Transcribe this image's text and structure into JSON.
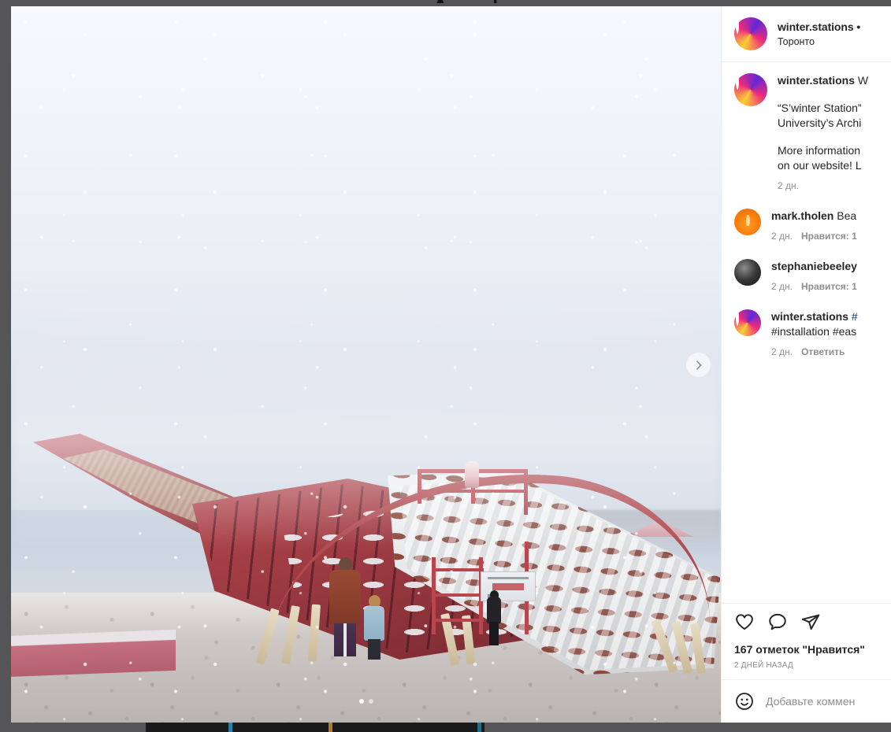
{
  "post": {
    "header": {
      "username": "winter.stations",
      "separator": "•",
      "location": "Торонто"
    },
    "caption": {
      "author": "winter.stations",
      "inline_text": "W",
      "paragraph_1_line_1": "“S’winter Station”",
      "paragraph_1_line_2": "University’s Archi",
      "paragraph_2_line_1": "More information",
      "paragraph_2_line_2": "on our website! L",
      "time": "2 дн."
    },
    "comments": [
      {
        "author": "mark.tholen",
        "text": "Bea",
        "time": "2 дн.",
        "likes": "Нравится: 1",
        "avatar": "flame-avatar"
      },
      {
        "author": "stephaniebeeley",
        "text": "",
        "time": "2 дн.",
        "likes": "Нравится: 1",
        "avatar": "dark-photo-avatar"
      },
      {
        "author": "winter.stations",
        "text": "#",
        "text_line_2": "#installation #eas",
        "time": "2 дн.",
        "reply": "Ответить",
        "avatar": "winter-stations-avatar"
      }
    ],
    "actions": {
      "like_icon": "heart-icon",
      "comment_icon": "speech-bubble-icon",
      "share_icon": "paper-plane-icon",
      "likes_count": "167 отметок \"Нравится\"",
      "posted_ago": "2 ДНЕЙ НАЗАД"
    },
    "add_comment": {
      "emoji_icon": "smiley-face-icon",
      "placeholder": "Добавьте коммен"
    },
    "media": {
      "next_icon": "chevron-right-icon",
      "slides_total": 2,
      "active_slide": 1
    }
  },
  "colors": {
    "text_primary": "#262626",
    "text_muted": "#8e8e8e",
    "link": "#00376b",
    "border": "#efefef",
    "chrome": "#555557",
    "accent_red": "#b14a50"
  }
}
